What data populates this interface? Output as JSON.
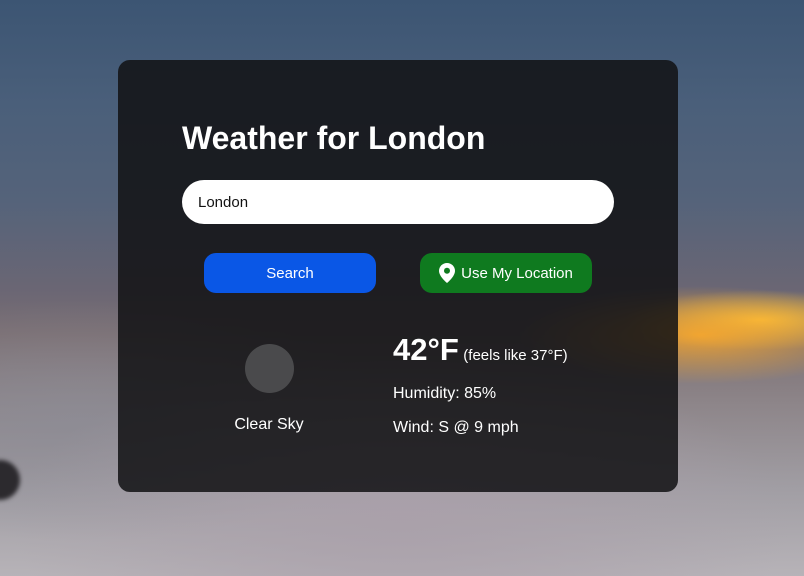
{
  "page": {
    "title": "Weather for London"
  },
  "search": {
    "value": "London",
    "search_label": "Search",
    "location_label": "Use My Location"
  },
  "weather": {
    "condition": "Clear Sky",
    "icon": "weather-condition-circle",
    "temperature": "42°F",
    "feels_like": "(feels like 37°F)",
    "humidity": "Humidity: 85%",
    "wind": "Wind: S @ 9 mph"
  },
  "colors": {
    "search_button": "#0a57e6",
    "location_button": "#0f7a1f",
    "card_background": "#121214"
  },
  "icons": {
    "location": "map-pin-icon"
  }
}
